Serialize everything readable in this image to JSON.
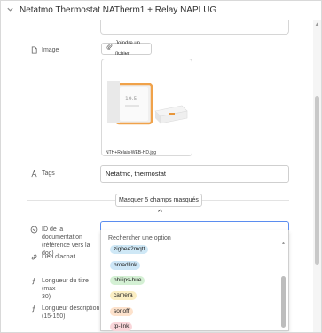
{
  "header": {
    "title": "Netatmo Thermostat NATherm1 + Relay NAPLUG",
    "chevron": "chevron-down-icon"
  },
  "fields": {
    "image": {
      "label": "Image",
      "button": "Joindre un fichier",
      "filename": "NTH+Relais-WEB-HD.jpg"
    },
    "tags": {
      "label": "Tags",
      "value": "Netatmo, thermostat"
    },
    "toggle_hidden": "Masquer 5 champs masqués",
    "doc_id": {
      "label_line1": "ID de la documentation",
      "label_line2": "(référence vers la doc)"
    },
    "buy_link": {
      "label": "Lien d'achat"
    },
    "title_length": {
      "label_line1": "Longueur du titre (max",
      "label_line2": "30)"
    },
    "desc_length": {
      "label_line1": "Longueur description",
      "label_line2": "(15-150)"
    }
  },
  "dropdown": {
    "search_placeholder": "Rechercher une option",
    "options": [
      {
        "label": "zigbee2mqtt",
        "color": "#cfe8f6"
      },
      {
        "label": "broadlink",
        "color": "#cde6f7"
      },
      {
        "label": "philips-hue",
        "color": "#d4f0d4"
      },
      {
        "label": "camera",
        "color": "#fbeec3"
      },
      {
        "label": "sonoff",
        "color": "#fde2cc"
      },
      {
        "label": "tp-link",
        "color": "#f9d6da"
      }
    ]
  }
}
